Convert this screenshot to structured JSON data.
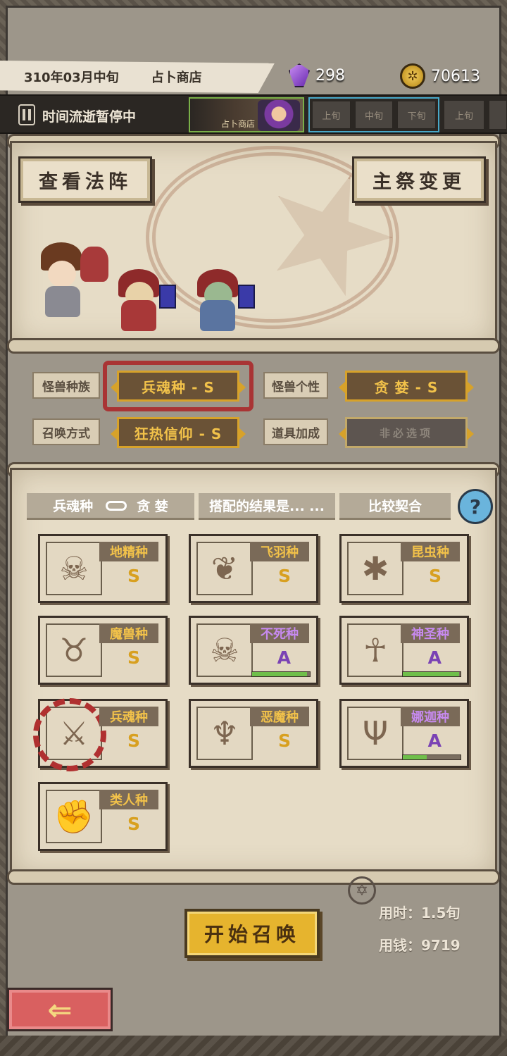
{
  "header": {
    "date": "310年03月中旬",
    "location": "占卜商店",
    "gems": "298",
    "gold": "70613"
  },
  "timebar": {
    "status": "时间流逝暂停中",
    "shop_label": "占卜商店",
    "xun": [
      "上旬",
      "中旬",
      "下旬",
      "上旬"
    ]
  },
  "top_panel": {
    "view_array_button": "查看法阵",
    "change_priest_button": "主祭变更"
  },
  "selectors": {
    "race_label": "怪兽种族",
    "race_value": "兵魂种 - S",
    "personality_label": "怪兽个性",
    "personality_value": "贪 婪 - S",
    "summon_label": "召唤方式",
    "summon_value": "狂热信仰 - S",
    "item_label": "道具加成",
    "item_value": "非必选项"
  },
  "combo": {
    "left": "兵魂种",
    "right": "贪 婪",
    "result": "搭配的结果是... ...",
    "verdict": "比较契合",
    "help": "?"
  },
  "species": [
    {
      "name": "地精种",
      "grade": "S",
      "icon": "goblin-skull-icon",
      "glyph": "☠"
    },
    {
      "name": "飞羽种",
      "grade": "S",
      "icon": "wings-icon",
      "glyph": "❦"
    },
    {
      "name": "昆虫种",
      "grade": "S",
      "icon": "insect-icon",
      "glyph": "✱"
    },
    {
      "name": "魔兽种",
      "grade": "S",
      "icon": "beast-icon",
      "glyph": "♉"
    },
    {
      "name": "不死种",
      "grade": "A",
      "icon": "undead-skull-icon",
      "glyph": "☠",
      "progress": 0.95
    },
    {
      "name": "神圣种",
      "grade": "A",
      "icon": "holy-halo-icon",
      "glyph": "☥",
      "progress": 0.98
    },
    {
      "name": "兵魂种",
      "grade": "S",
      "icon": "soldier-spirit-icon",
      "glyph": "⚔",
      "selected": true
    },
    {
      "name": "恶魔种",
      "grade": "S",
      "icon": "demon-icon",
      "glyph": "♆"
    },
    {
      "name": "娜迦种",
      "grade": "A",
      "icon": "trident-icon",
      "glyph": "Ψ",
      "progress": 0.42
    },
    {
      "name": "类人种",
      "grade": "S",
      "icon": "fist-icon",
      "glyph": "✊"
    }
  ],
  "summary": {
    "time_cost": "用时：1.5旬",
    "money_cost": "用钱：9719"
  },
  "actions": {
    "start_button": "开始召唤",
    "back_arrow": "⇐"
  },
  "colors": {
    "gold_text": "#f2c24a",
    "purple_text": "#c78af0",
    "selection_red": "#a93434",
    "progress_green": "#6fbf4a"
  }
}
